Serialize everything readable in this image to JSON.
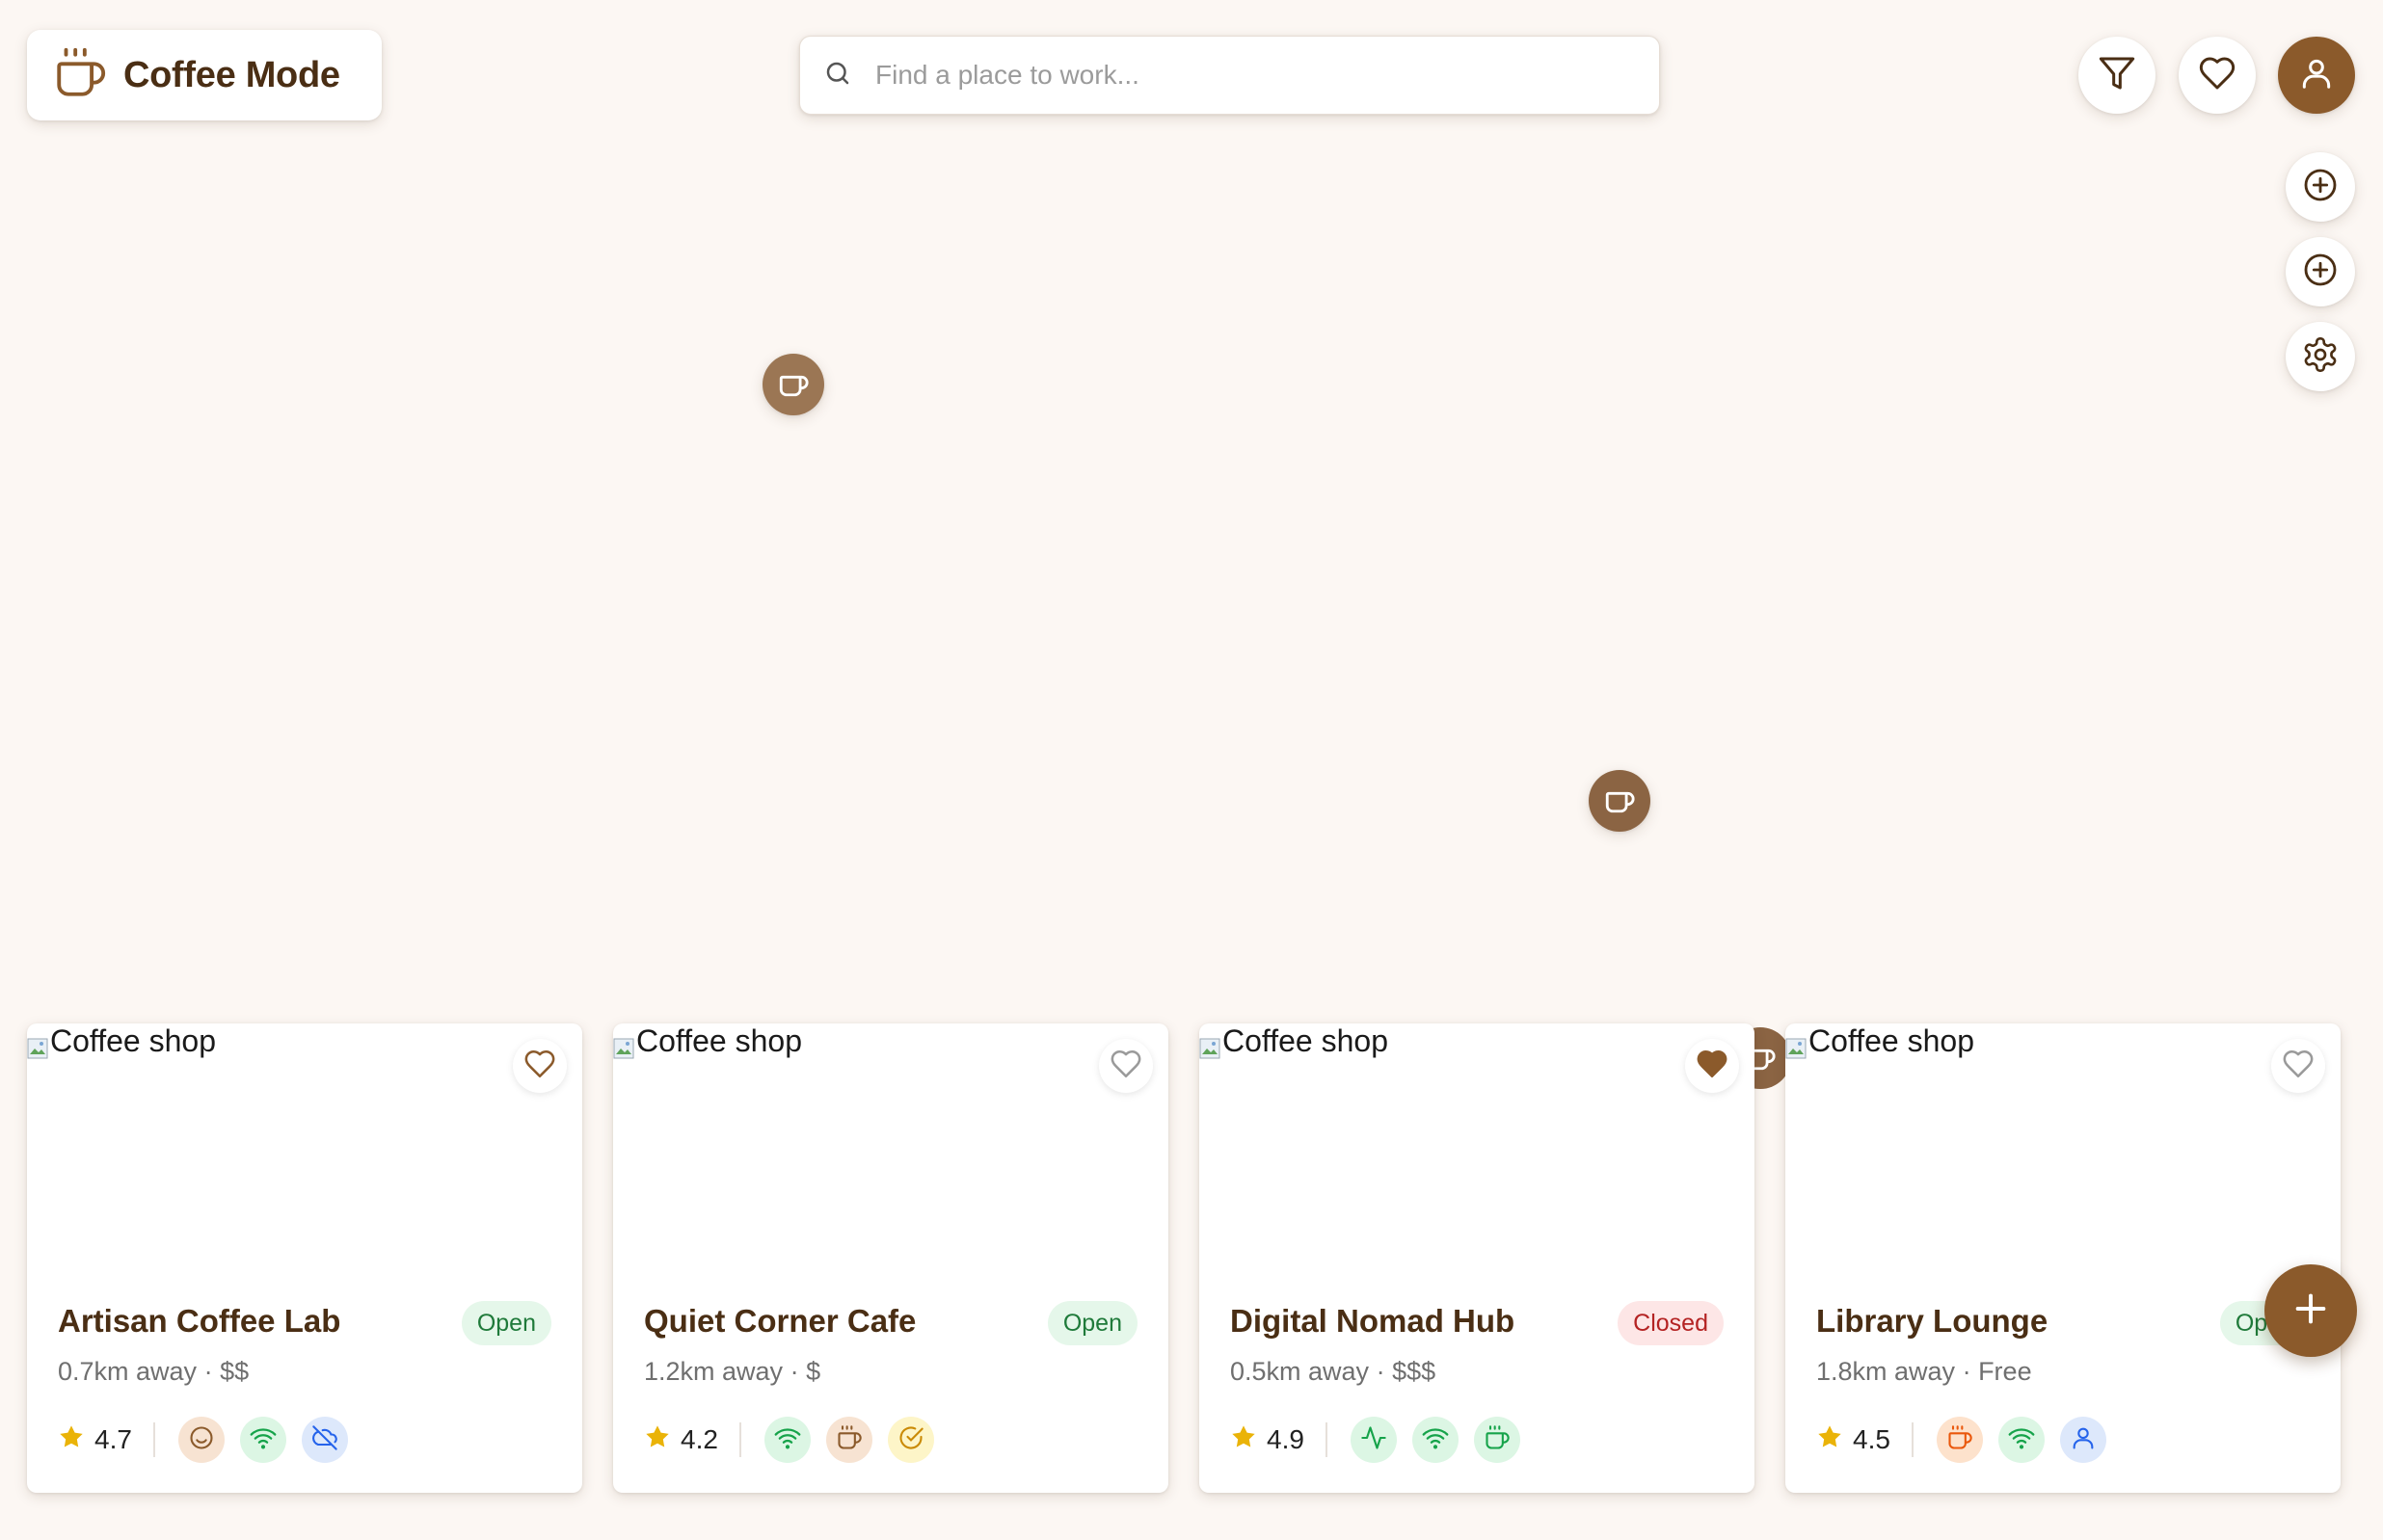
{
  "app": {
    "name": "Coffee Mode"
  },
  "search": {
    "placeholder": "Find a place to work..."
  },
  "cards": [
    {
      "name": "Artisan Coffee Lab",
      "status": "Open",
      "distance": "0.7km away",
      "price": "$$",
      "rating": "4.7",
      "image_alt": "Coffee shop",
      "favorited": false,
      "amenities": [
        "smile-icon",
        "wifi-icon",
        "cloud-off-icon"
      ]
    },
    {
      "name": "Quiet Corner Cafe",
      "status": "Open",
      "distance": "1.2km away",
      "price": "$",
      "rating": "4.2",
      "image_alt": "Coffee shop",
      "favorited": false,
      "amenities": [
        "wifi-icon",
        "coffee-icon",
        "check-circle-icon"
      ]
    },
    {
      "name": "Digital Nomad Hub",
      "status": "Closed",
      "distance": "0.5km away",
      "price": "$$$",
      "rating": "4.9",
      "image_alt": "Coffee shop",
      "favorited": true,
      "amenities": [
        "activity-icon",
        "wifi-icon",
        "coffee-icon"
      ]
    },
    {
      "name": "Library Lounge",
      "status": "Open",
      "distance": "1.8km away",
      "price": "Free",
      "rating": "4.5",
      "image_alt": "Coffee shop",
      "favorited": false,
      "amenities": [
        "coffee-icon",
        "wifi-icon",
        "user-icon"
      ]
    }
  ],
  "colors": {
    "brand": "#8b5a2b",
    "background": "#fcf7f3",
    "open": "#1f7a3a",
    "closed": "#b42323",
    "star": "#eab308"
  }
}
